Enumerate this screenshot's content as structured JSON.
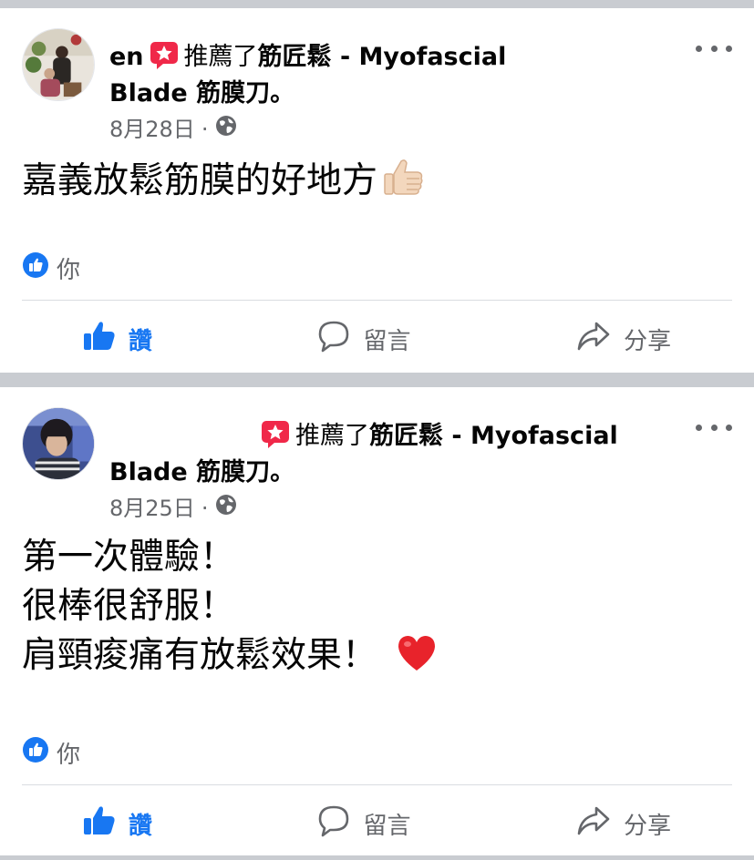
{
  "posts": [
    {
      "author_fragment": "en",
      "recommend_verb": "推薦了",
      "page_name_line1": "筋匠鬆 - Myofascial",
      "page_name_line2": "Blade 筋膜刀。",
      "date": "8月28日",
      "separator": "·",
      "text_lines": [
        "嘉義放鬆筋膜的好地方"
      ],
      "text_emoji": "thumbs-up-emoji",
      "reaction_names": "你",
      "actions": {
        "like": "讚",
        "comment": "留言",
        "share": "分享"
      }
    },
    {
      "author_fragment": "",
      "recommend_verb": "推薦了",
      "page_name_line1": "筋匠鬆 - Myofascial",
      "page_name_line2": "Blade 筋膜刀。",
      "date": "8月25日",
      "separator": "·",
      "text_lines": [
        "第一次體驗！",
        "很棒很舒服！",
        "肩頸痠痛有放鬆效果！"
      ],
      "text_emoji": "red-heart-emoji",
      "reaction_names": "你",
      "actions": {
        "like": "讚",
        "comment": "留言",
        "share": "分享"
      }
    }
  ],
  "colors": {
    "accent_blue": "#1877f2",
    "recommend_red": "#f02849",
    "secondary_text": "#65676b",
    "feed_background": "#c9ccd1"
  }
}
